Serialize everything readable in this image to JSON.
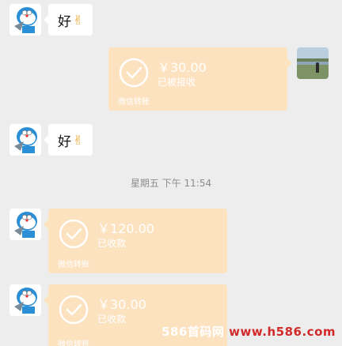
{
  "messages": {
    "m1": {
      "text": "好",
      "emoji_icon": "ok-hand-icon"
    },
    "m2": {
      "amount": "￥30.00",
      "status": "已被接收",
      "footer": "微信转账"
    },
    "m3": {
      "text": "好",
      "emoji_icon": "ok-hand-icon"
    },
    "m4": {
      "amount": "￥120.00",
      "status": "已收款",
      "footer": "微信转账"
    },
    "m5": {
      "amount": "￥30.00",
      "status": "已收款",
      "footer": "微信转账"
    }
  },
  "timestamp": "星期五 下午 11:54",
  "watermark": {
    "prefix": "586首码网 ",
    "domain": "www.h586.com"
  },
  "colors": {
    "background": "#ededed",
    "transfer_bubble": "#fde2c0",
    "text_bubble": "#ffffff",
    "watermark_accent": "#d22a2a"
  }
}
